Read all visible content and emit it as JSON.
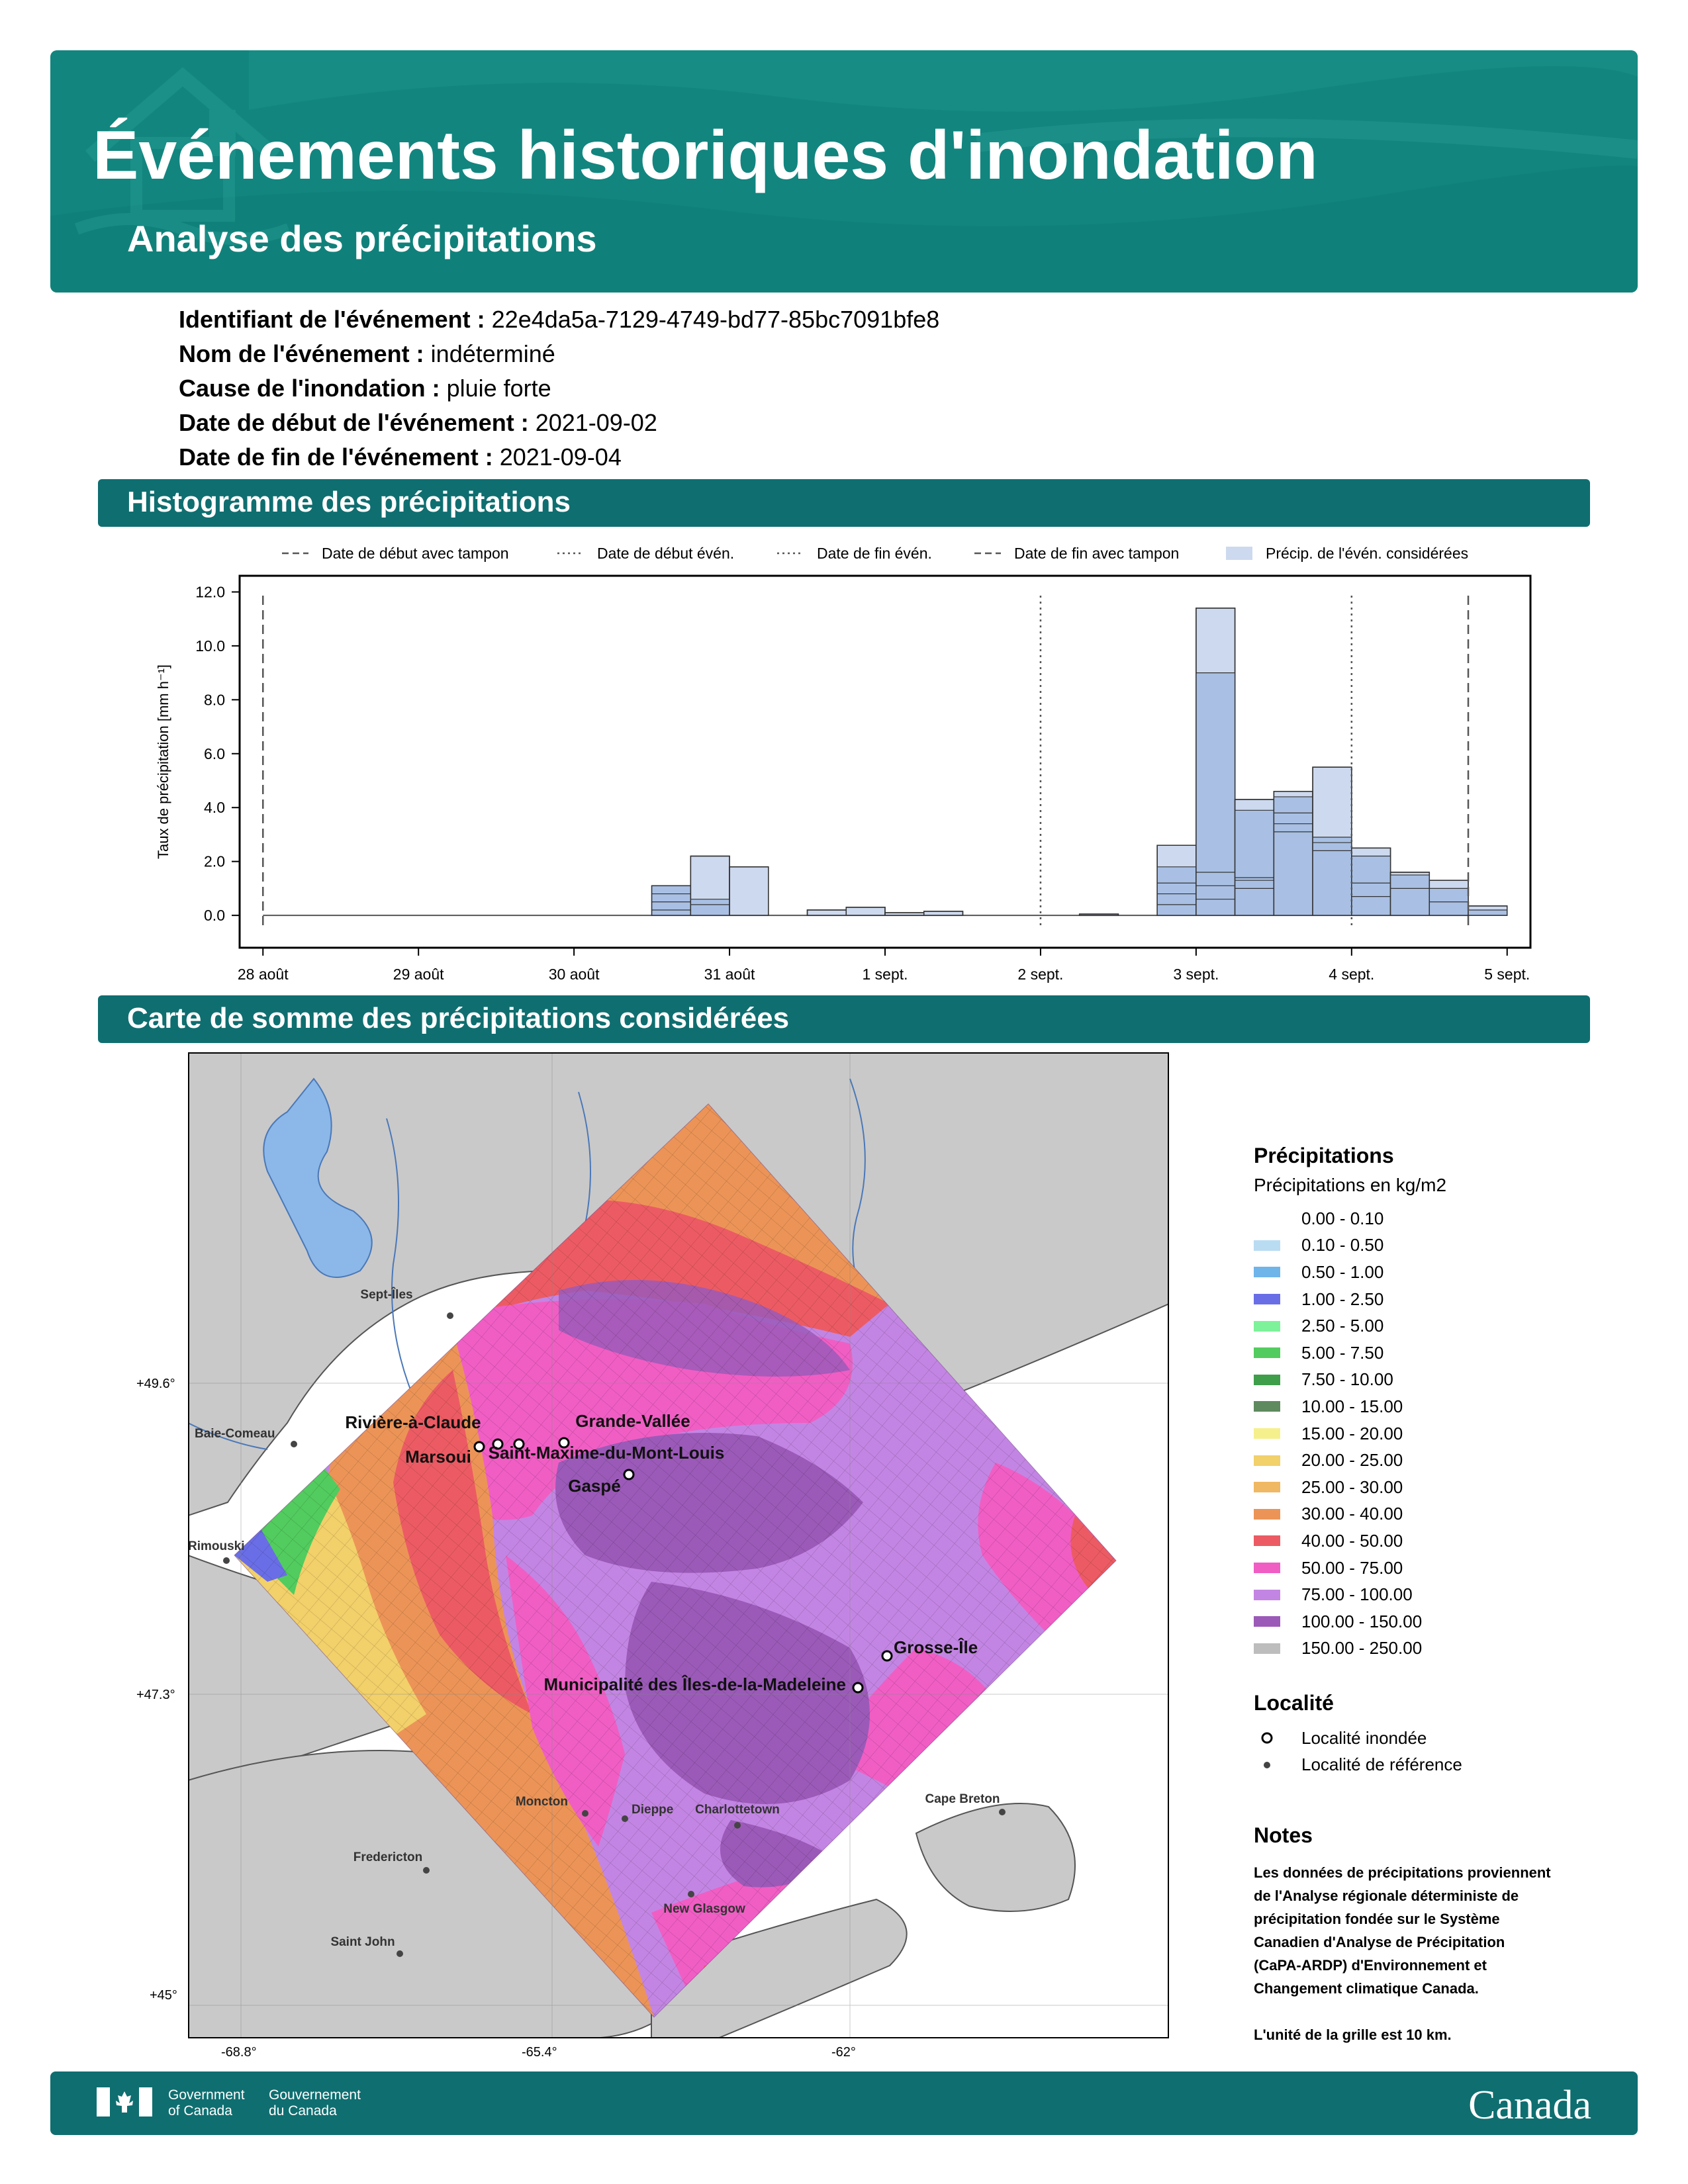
{
  "header": {
    "title": "Événements historiques d'inondation",
    "subtitle": "Analyse des précipitations"
  },
  "event_info": [
    {
      "label": "Identifiant de l'événement :",
      "value": "22e4da5a-7129-4749-bd77-85bc7091bfe8"
    },
    {
      "label": "Nom de l'événement :",
      "value": "indéterminé"
    },
    {
      "label": "Cause de l'inondation :",
      "value": "pluie forte"
    },
    {
      "label": "Date de début de l'événement :",
      "value": "2021-09-02"
    },
    {
      "label": "Date de fin de l'événement :",
      "value": "2021-09-04"
    }
  ],
  "sections": {
    "histogram": "Histogramme des précipitations",
    "map": "Carte de somme des précipitations considérées"
  },
  "chart_data": {
    "type": "bar",
    "ylabel": "Taux de précipitation [mm h⁻¹]",
    "ylim": [
      -1.2,
      12.6
    ],
    "yticks": [
      "0.0",
      "2.0",
      "4.0",
      "6.0",
      "8.0",
      "10.0",
      "12.0"
    ],
    "xlim": [
      -0.15,
      8.15
    ],
    "xtick_labels": [
      "28 août",
      "29 août",
      "30 août",
      "31 août",
      "1 sept.",
      "2 sept.",
      "3 sept.",
      "4 sept.",
      "5 sept."
    ],
    "legend": [
      {
        "label": "Date de début avec tampon",
        "style": "dashed"
      },
      {
        "label": "Date de début évén.",
        "style": "dotted"
      },
      {
        "label": "Date de fin évén.",
        "style": "dotted"
      },
      {
        "label": "Date de fin avec tampon",
        "style": "dashed"
      },
      {
        "label": "Précip. de l'évén. considérées",
        "style": "patch"
      }
    ],
    "vlines": [
      {
        "x": 0.0,
        "style": "dashed"
      },
      {
        "x": 5.0,
        "style": "dotted"
      },
      {
        "x": 7.0,
        "style": "dotted"
      },
      {
        "x": 7.75,
        "style": "dashed"
      }
    ],
    "bin_hours": 6,
    "bars": [
      {
        "start": "2021-08-30 12:00",
        "total": 1.1,
        "layers": [
          0.2,
          0.5,
          0.8,
          1.1
        ]
      },
      {
        "start": "2021-08-30 18:00",
        "total": 2.2,
        "layers": [
          0.4,
          0.6
        ]
      },
      {
        "start": "2021-08-31 00:00",
        "total": 1.8,
        "layers": []
      },
      {
        "start": "2021-08-31 12:00",
        "total": 0.2,
        "layers": []
      },
      {
        "start": "2021-08-31 18:00",
        "total": 0.3,
        "layers": []
      },
      {
        "start": "2021-09-01 00:00",
        "total": 0.1,
        "layers": []
      },
      {
        "start": "2021-09-01 06:00",
        "total": 0.15,
        "layers": []
      },
      {
        "start": "2021-09-02 06:00",
        "total": 0.05,
        "layers": []
      },
      {
        "start": "2021-09-02 18:00",
        "total": 2.6,
        "layers": [
          0.4,
          0.8,
          1.2,
          1.8
        ]
      },
      {
        "start": "2021-09-03 00:00",
        "total": 11.4,
        "layers": [
          0.6,
          1.1,
          1.6,
          9.0
        ]
      },
      {
        "start": "2021-09-03 06:00",
        "total": 4.3,
        "layers": [
          1.0,
          1.3,
          1.4,
          3.9
        ]
      },
      {
        "start": "2021-09-03 12:00",
        "total": 4.6,
        "layers": [
          3.1,
          3.4,
          3.8,
          4.4
        ]
      },
      {
        "start": "2021-09-03 18:00",
        "total": 5.5,
        "layers": [
          2.4,
          2.7,
          2.9
        ]
      },
      {
        "start": "2021-09-04 00:00",
        "total": 2.5,
        "layers": [
          0.7,
          1.2,
          2.2
        ]
      },
      {
        "start": "2021-09-04 06:00",
        "total": 1.6,
        "layers": [
          1.0,
          1.5
        ]
      },
      {
        "start": "2021-09-04 12:00",
        "total": 1.3,
        "layers": [
          0.5,
          1.0
        ]
      },
      {
        "start": "2021-09-04 18:00",
        "total": 0.35,
        "layers": [
          0.2
        ]
      }
    ]
  },
  "map": {
    "lat_labels": [
      "+49.6°",
      "+47.3°",
      "+45°"
    ],
    "lon_labels": [
      "-68.8°",
      "-65.4°",
      "-62°"
    ],
    "flooded_localities": [
      "Rivière-à-Claude",
      "Grande-Vallée",
      "Marsoui",
      "Saint-Maxime-du-Mont-Louis",
      "Gaspé",
      "Grosse-Île",
      "Municipalité des Îles-de-la-Madeleine"
    ],
    "reference_localities": [
      "Sept-Îles",
      "Baie-Comeau",
      "Rimouski",
      "Charlottetown",
      "Moncton",
      "Dieppe",
      "Cape Breton",
      "Fredericton",
      "Saint John",
      "New Glasgow"
    ]
  },
  "legend": {
    "title": "Précipitations",
    "subtitle": "Précipitations en kg/m2",
    "classes": [
      {
        "range": "0.00 - 0.10",
        "color": "#ffffff"
      },
      {
        "range": "0.10 - 0.50",
        "color": "#b9dcf2"
      },
      {
        "range": "0.50 - 1.00",
        "color": "#6fb5ea"
      },
      {
        "range": "1.00 - 2.50",
        "color": "#6a6ee6"
      },
      {
        "range": "2.50 - 5.00",
        "color": "#7df29a"
      },
      {
        "range": "5.00 - 7.50",
        "color": "#52cc5e"
      },
      {
        "range": "7.50 - 10.00",
        "color": "#3f9e4a"
      },
      {
        "range": "10.00 - 15.00",
        "color": "#5f8a5f"
      },
      {
        "range": "15.00 - 20.00",
        "color": "#f5f08c"
      },
      {
        "range": "20.00 - 25.00",
        "color": "#f2d06a"
      },
      {
        "range": "25.00 - 30.00",
        "color": "#f0b863"
      },
      {
        "range": "30.00 - 40.00",
        "color": "#ec9457"
      },
      {
        "range": "40.00 - 50.00",
        "color": "#ec5b63"
      },
      {
        "range": "50.00 - 75.00",
        "color": "#f05ec4"
      },
      {
        "range": "75.00 - 100.00",
        "color": "#c385e3"
      },
      {
        "range": "100.00 - 150.00",
        "color": "#9b5ab8"
      },
      {
        "range": "150.00 - 250.00",
        "color": "#bdbdbd"
      }
    ],
    "locality_title": "Localité",
    "locality_flooded": "Localité inondée",
    "locality_reference": "Localité de référence"
  },
  "notes": {
    "title": "Notes",
    "lines": [
      "Les données de précipitations proviennent",
      "de l'Analyse régionale déterministe de",
      "précipitation fondée sur le Système",
      "Canadien d'Analyse de Précipitation",
      "(CaPA-ARDP) d'Environnement et",
      "Changement climatique Canada."
    ],
    "grid_note": "L'unité de la grille est 10 km."
  },
  "footer": {
    "gov_en_1": "Government",
    "gov_en_2": "of Canada",
    "gov_fr_1": "Gouvernement",
    "gov_fr_2": "du Canada",
    "wordmark": "Canada"
  },
  "colors": {
    "header_teal": "#12857f",
    "band_teal": "#0f6e70",
    "bar_fill": "#b4c8e6",
    "bar_layer": "#9bb6de"
  }
}
